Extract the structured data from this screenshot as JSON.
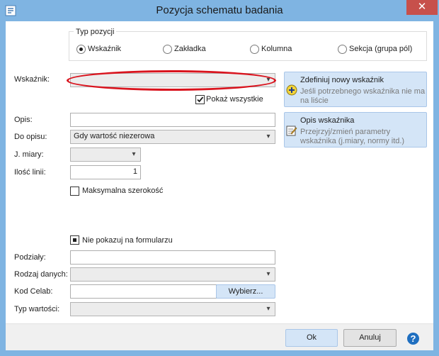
{
  "window": {
    "title": "Pozycja schematu badania",
    "close_glyph": "✕",
    "app_icon": "app-icon"
  },
  "group": {
    "title": "Typ pozycji",
    "options": [
      {
        "label": "Wskaźnik",
        "selected": true
      },
      {
        "label": "Zakładka",
        "selected": false
      },
      {
        "label": "Kolumna",
        "selected": false
      },
      {
        "label": "Sekcja (grupa pól)",
        "selected": false
      }
    ]
  },
  "form": {
    "wskaznik_label": "Wskaźnik:",
    "wskaznik_value": "",
    "show_all_label": "Pokaż wszystkie",
    "show_all_checked": true,
    "opis_label": "Opis:",
    "opis_value": "",
    "do_opisu_label": "Do opisu:",
    "do_opisu_value": "Gdy wartość niezerowa",
    "jm_label": "J. miary:",
    "jm_value": "",
    "lines_label": "Ilość linii:",
    "lines_value": "1",
    "max_width_label": "Maksymalna szerokość",
    "max_width_checked": false,
    "hide_label": "Nie pokazuj na formularzu",
    "hide_checked": true,
    "podzialy_label": "Podziały:",
    "podzialy_value": "",
    "rodzaj_label": "Rodzaj danych:",
    "rodzaj_value": "",
    "kod_label": "Kod Celab:",
    "kod_value": "",
    "wybierz_label": "Wybierz...",
    "typ_label": "Typ wartości:",
    "typ_value": ""
  },
  "side_buttons": {
    "define": {
      "title": "Zdefiniuj nowy wskaźnik",
      "sub1": "Jeśli potrzebnego wskaźnika nie ma",
      "sub2": "na liście",
      "icon": "plus-circle-icon"
    },
    "describe": {
      "title": "Opis wskaźnika",
      "sub1": "Przejrzyj/zmień parametry",
      "sub2": "wskaźnika (j.miary, normy itd.)",
      "icon": "edit-note-icon"
    }
  },
  "footer": {
    "ok_label": "Ok",
    "cancel_label": "Anuluj",
    "help_glyph": "?",
    "help_icon": "help-icon"
  },
  "colors": {
    "title_bar": "#7fb4e2",
    "close_button": "#c7504b",
    "annotation": "#d9141e",
    "side_button": "#d4e5f7"
  }
}
